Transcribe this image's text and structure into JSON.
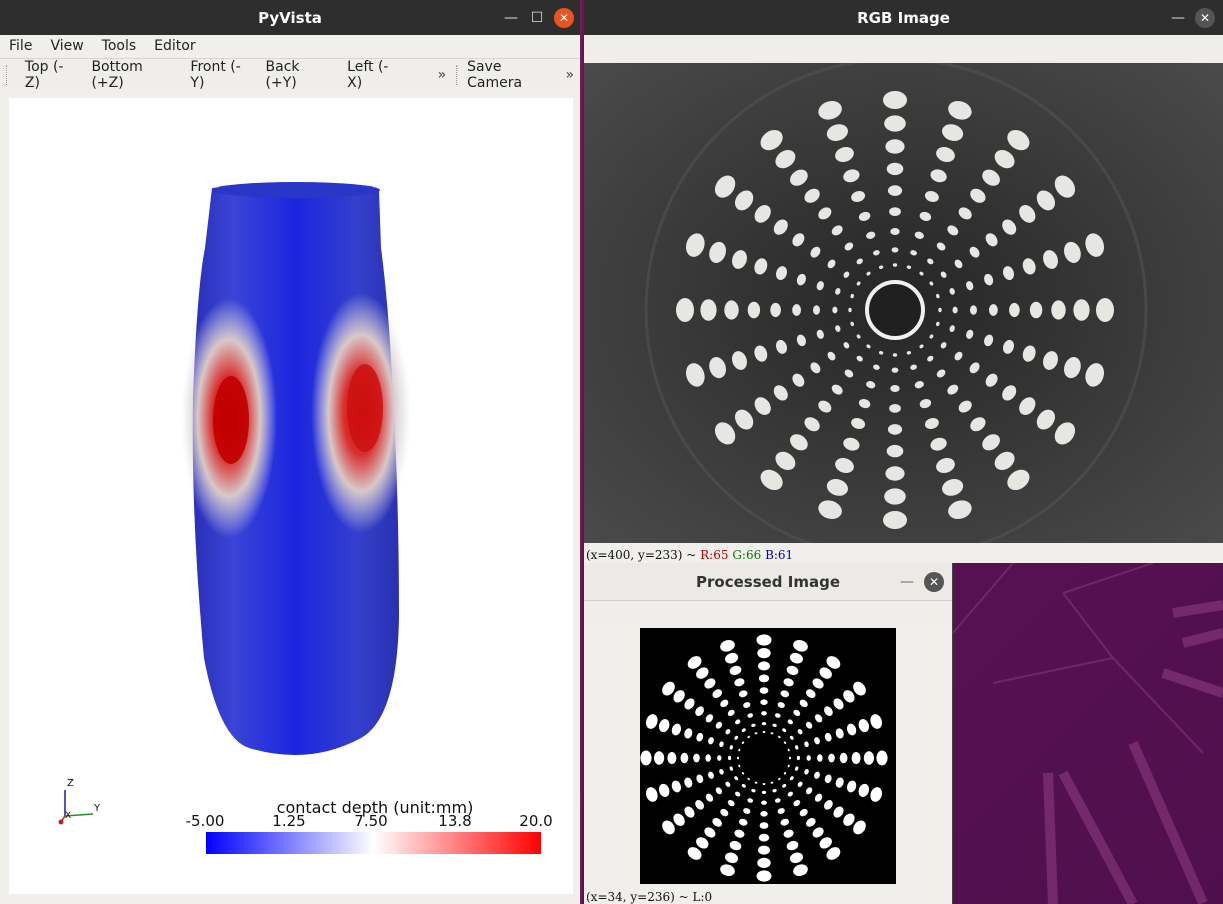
{
  "pyvista": {
    "title": "PyVista",
    "menu": [
      "File",
      "View",
      "Tools",
      "Editor"
    ],
    "toolbar": [
      "Top (-Z)",
      "Bottom (+Z)",
      "Front (-Y)",
      "Back (+Y)",
      "Left (-X)"
    ],
    "more_label": "»",
    "save_camera": "Save Camera",
    "more_label2": "»",
    "scalar_bar": {
      "title": "contact depth (unit:mm)",
      "ticks": [
        "-5.00",
        "1.25",
        "7.50",
        "13.8",
        "20.0"
      ],
      "colors": {
        "low": "#0000ff",
        "mid": "#ffffff",
        "high": "#ff0000"
      }
    },
    "axes": {
      "z": "Z",
      "y": "Y",
      "x": "X"
    }
  },
  "rgb": {
    "title": "RGB Image",
    "status_prefix": "(x=400, y=233) ~ ",
    "r": "R:65",
    "g": "G:66",
    "b": "B:61"
  },
  "processed": {
    "title": "Processed Image",
    "status": "(x=34, y=236) ~ L:0"
  },
  "colors": {
    "title_bar": "#2e2e2e",
    "close_button": "#e95420",
    "desktop": "#5e1a4e"
  },
  "icons": {
    "minimize": "minimize-icon",
    "maximize": "maximize-icon",
    "close": "close-icon"
  }
}
